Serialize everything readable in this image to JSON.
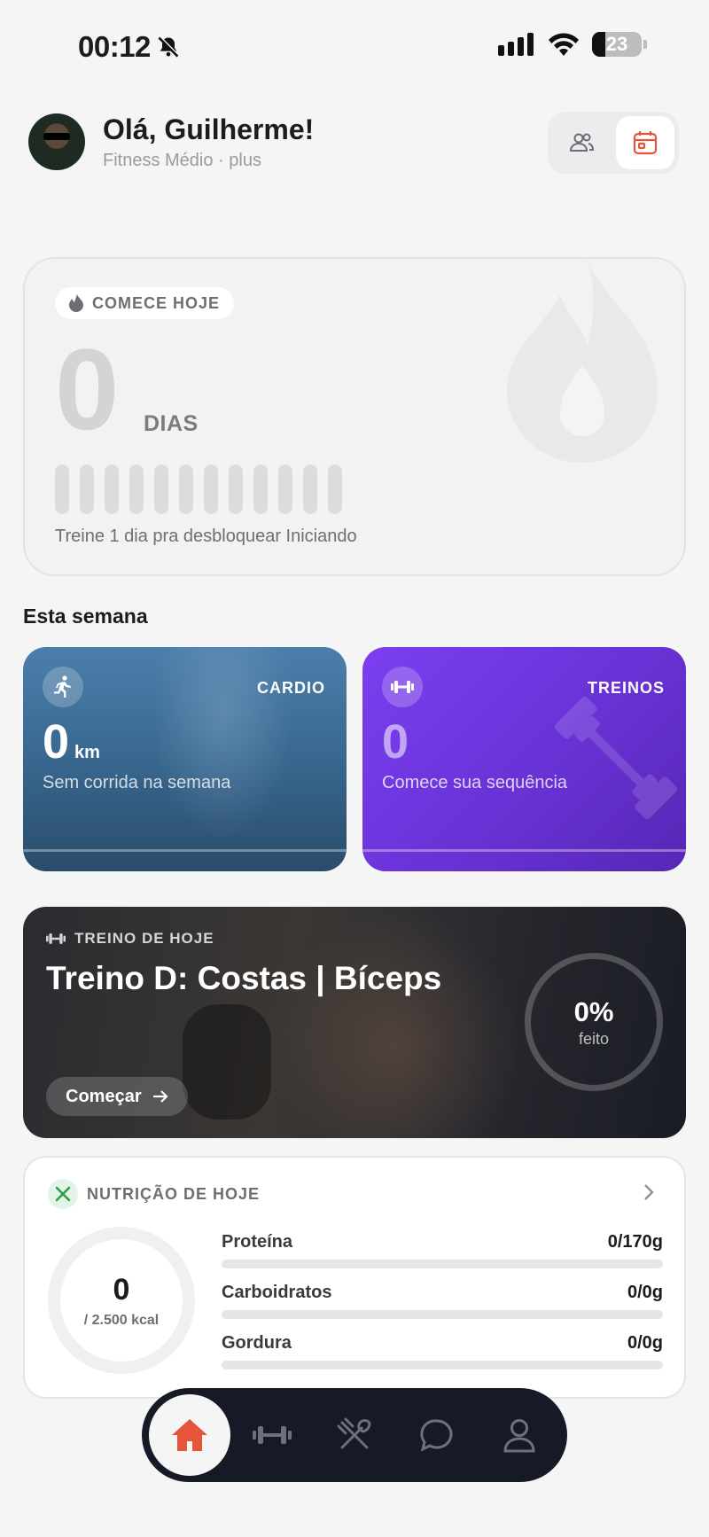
{
  "status": {
    "time": "00:12",
    "battery": "23"
  },
  "header": {
    "greeting": "Olá, Guilherme!",
    "subtitle": "Fitness Médio · plus"
  },
  "streak": {
    "pill": "COMECE HOJE",
    "count": "0",
    "unit": "DIAS",
    "hint": "Treine 1 dia pra desbloquear Iniciando"
  },
  "week": {
    "title": "Esta semana",
    "cardio": {
      "label": "CARDIO",
      "value": "0",
      "unit": "km",
      "desc": "Sem corrida na semana"
    },
    "treinos": {
      "label": "TREINOS",
      "value": "0",
      "desc": "Comece sua sequência"
    }
  },
  "workout": {
    "tag": "TREINO DE HOJE",
    "title": "Treino D: Costas | Bíceps",
    "button": "Começar",
    "progress": "0%",
    "progress_label": "feito"
  },
  "nutrition": {
    "title": "NUTRIÇÃO DE HOJE",
    "kcal_value": "0",
    "kcal_target": "/ 2.500 kcal",
    "macros": [
      {
        "name": "Proteína",
        "value": "0/170g"
      },
      {
        "name": "Carboidratos",
        "value": "0/0g"
      },
      {
        "name": "Gordura",
        "value": "0/0g"
      }
    ]
  },
  "colors": {
    "accent": "#e5553a",
    "cardio": "#3a6a92",
    "treinos": "#6a33d8",
    "tabbar": "#151a26"
  },
  "icons": {
    "header": [
      "community-icon",
      "calendar-icon"
    ],
    "tabs": [
      "home-icon",
      "dumbbell-icon",
      "fork-knife-icon",
      "chat-icon",
      "profile-icon"
    ]
  }
}
